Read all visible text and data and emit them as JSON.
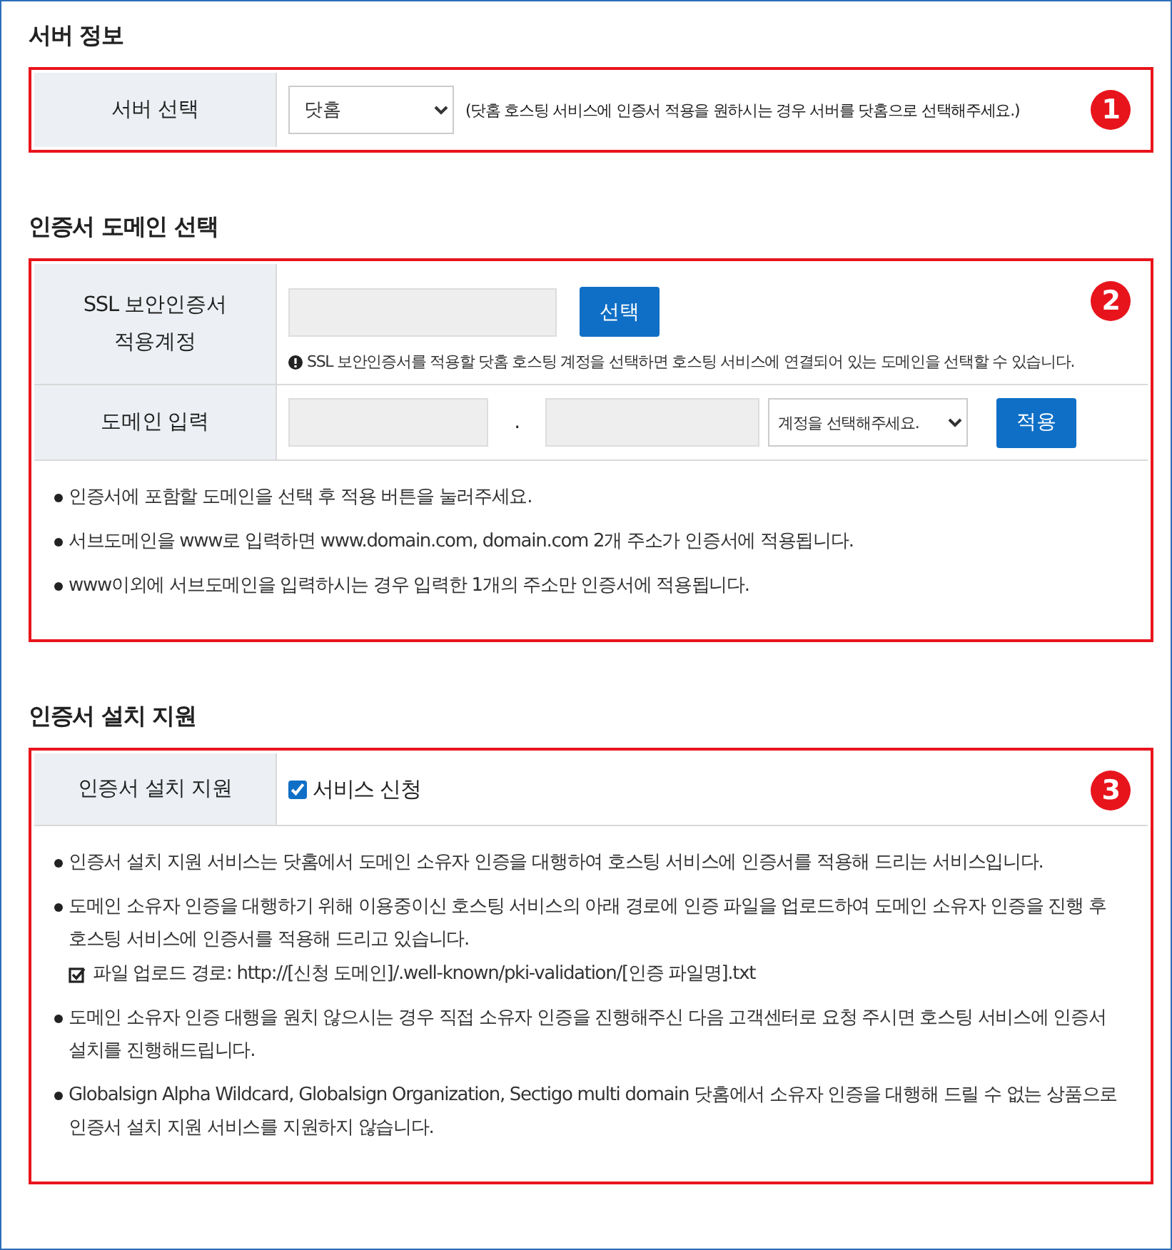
{
  "sections": [
    {
      "title": "서버 정보",
      "marker": "1",
      "rows": [
        {
          "kind": "select",
          "label": "서버 선택",
          "value": "닷홈",
          "hint": "(닷홈 호스팅 서비스에 인증서 적용을 원하시는 경우 서버를 닷홈으로 선택해주세요.)"
        }
      ]
    },
    {
      "title": "인증서 도메인 선택",
      "marker": "2",
      "rows": [
        {
          "kind": "account",
          "label": "SSL 보안인증서\n적용계정",
          "button": "선택",
          "info": "SSL 보안인증서를 적용할 닷홈 호스팅 계정을 선택하면 호스팅 서비스에 연결되어 있는 도메인을 선택할 수 있습니다."
        },
        {
          "kind": "domain",
          "label": "도메인 입력",
          "separator": ".",
          "value": "계정을 선택해주세요.",
          "button": "적용"
        }
      ],
      "notes": [
        {
          "text": "인증서에 포함할 도메인을 선택 후 적용 버튼을 눌러주세요."
        },
        {
          "text": "서브도메인을 www로 입력하면 www.domain.com, domain.com 2개 주소가 인증서에 적용됩니다."
        },
        {
          "text": "www이외에 서브도메인을 입력하시는 경우 입력한 1개의 주소만 인증서에 적용됩니다."
        }
      ]
    },
    {
      "title": "인증서 설치 지원",
      "marker": "3",
      "rows": [
        {
          "kind": "checkbox",
          "label": "인증서 설치 지원",
          "option": "서비스 신청",
          "checked": true
        }
      ],
      "notes": [
        {
          "text": "인증서 설치 지원 서비스는 닷홈에서 도메인 소유자 인증을 대행하여 호스팅 서비스에 인증서를 적용해 드리는 서비스입니다."
        },
        {
          "text": "도메인 소유자 인증을 대행하기 위해 이용중이신 호스팅 서비스의 아래 경로에 인증 파일을 업로드하여 도메인 소유자 인증을 진행 후 호스팅 서비스에 인증서를 적용해 드리고 있습니다.",
          "sub": "파일 업로드 경로: http://[신청 도메인]/.well-known/pki-validation/[인증 파일명].txt"
        },
        {
          "text": "도메인 소유자 인증 대행을 원치 않으시는 경우 직접 소유자 인증을 진행해주신 다음 고객센터로 요청 주시면 호스팅 서비스에 인증서 설치를 진행해드립니다."
        },
        {
          "text": "Globalsign Alpha Wildcard, Globalsign Organization, Sectigo multi domain 닷홈에서 소유자 인증을 대행해 드릴 수 없는 상품으로 인증서 설치 지원 서비스를 지원하지 않습니다."
        }
      ]
    }
  ]
}
